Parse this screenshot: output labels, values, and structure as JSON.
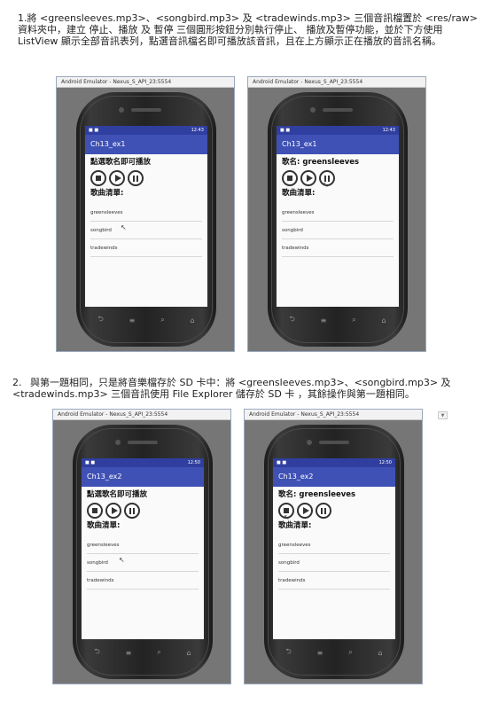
{
  "q1": {
    "text": "1.將 <greensleeves.mp3>、<songbird.mp3> 及 <tradewinds.mp3> 三個音訊檔置於 <res/raw> 資料夾中，建立 停止、播放 及 暫停 三個圓形按鈕分別執行停止、 播放及暫停功能，並於下方使用 ListView 顯示全部音訊表列，點選音訊檔名即可播放該音訊，且在上方顯示正在播放的音訊名稱。"
  },
  "q2": {
    "number": "2.",
    "text": "與第一題相同，只是將音樂檔存於 SD 卡中：將 <greensleeves.mp3>、<songbird.mp3> 及 <tradewinds.mp3> 三個音訊使用 File Explorer 儲存於 SD 卡 ，其餘操作與第一題相同。"
  },
  "emulators": [
    {
      "window_title": "Android Emulator - Nexus_S_API_23:5554",
      "time": "12:43",
      "app_title": "Ch13_ex1",
      "heading": "點選歌名即可播放",
      "list_header": "歌曲清單:",
      "songs": [
        "greensleeves",
        "songbird",
        "tradewinds"
      ]
    },
    {
      "window_title": "Android Emulator - Nexus_S_API_23:5554",
      "time": "12:43",
      "app_title": "Ch13_ex1",
      "heading": "歌名: greensleeves",
      "list_header": "歌曲清單:",
      "songs": [
        "greensleeves",
        "songbird",
        "tradewinds"
      ]
    },
    {
      "window_title": "Android Emulator - Nexus_S_API_23:5554",
      "time": "12:50",
      "app_title": "Ch13_ex2",
      "heading": "點選歌名即可播放",
      "list_header": "歌曲清單:",
      "songs": [
        "greensleeves",
        "songbird",
        "tradewinds"
      ]
    },
    {
      "window_title": "Android Emulator - Nexus_S_API_23:5554",
      "time": "12:50",
      "app_title": "Ch13_ex2",
      "heading": "歌名: greensleeves",
      "list_header": "歌曲清單:",
      "songs": [
        "greensleeves",
        "songbird",
        "tradewinds"
      ]
    }
  ],
  "icons": {
    "stop": "stop-icon",
    "play": "play-icon",
    "pause": "pause-icon",
    "back": "back-icon",
    "home": "home-icon",
    "search": "search-icon",
    "menu": "menu-icon"
  }
}
